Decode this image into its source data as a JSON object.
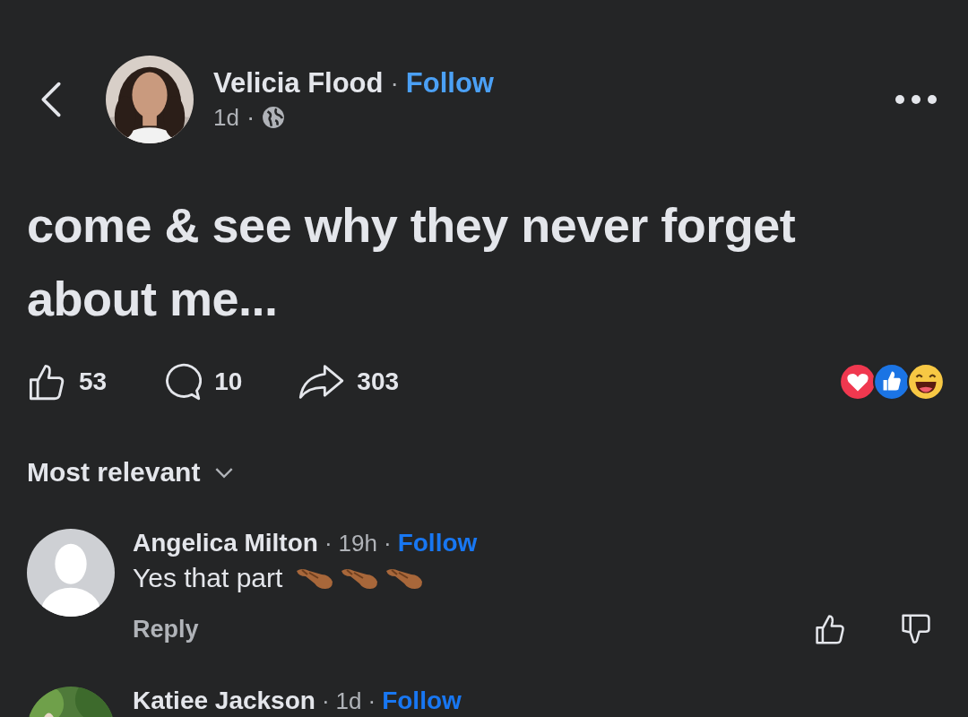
{
  "separator": "·",
  "post": {
    "author": "Velicia Flood",
    "follow": "Follow",
    "time": "1d",
    "text": "come & see why they never forget about me...",
    "stats": [
      {
        "kind": "like",
        "count": "53"
      },
      {
        "kind": "comment",
        "count": "10"
      },
      {
        "kind": "share",
        "count": "303"
      }
    ],
    "reactions": [
      {
        "kind": "love"
      },
      {
        "kind": "like"
      },
      {
        "kind": "haha"
      }
    ]
  },
  "sort": "Most relevant",
  "comments": [
    {
      "author": "Angelica Milton",
      "time": "19h",
      "follow": "Follow",
      "avatar": {
        "kind": "silhouette"
      },
      "text": "Yes that part",
      "emojis": [
        {
          "kind": "pinch"
        },
        {
          "kind": "pinch"
        },
        {
          "kind": "pinch"
        }
      ],
      "reply": "Reply"
    },
    {
      "author": "Katiee Jackson",
      "time": "1d",
      "follow": "Follow"
    }
  ]
}
